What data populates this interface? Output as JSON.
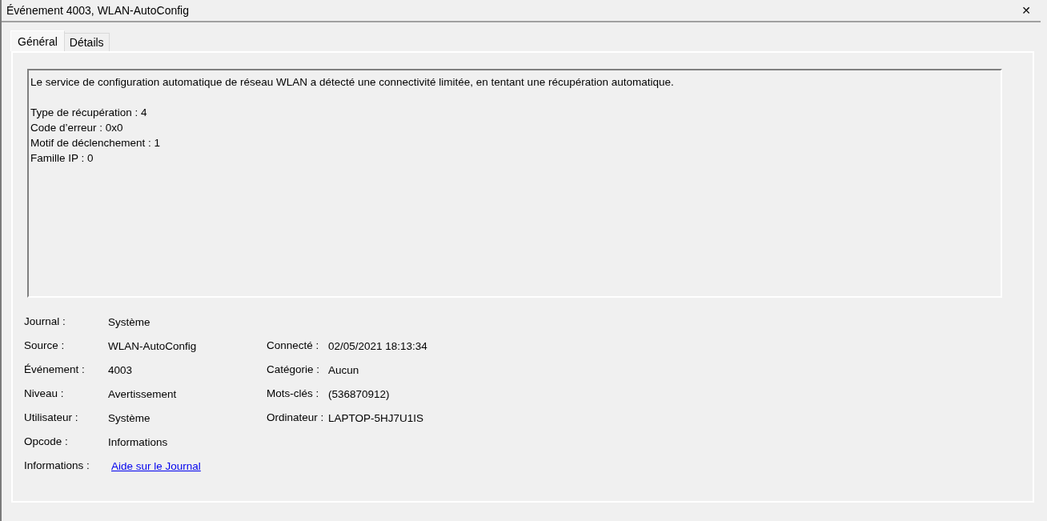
{
  "window": {
    "title": "Événement 4003, WLAN-AutoConfig",
    "close": "✕"
  },
  "tabs": [
    {
      "label": "Général",
      "selected": true
    },
    {
      "label": "Détails",
      "selected": false
    }
  ],
  "message": {
    "summary": "Le service de configuration automatique de réseau WLAN a détecté une connectivité limitée, en tentant une récupération automatique.",
    "lines": [
      "Type de récupération : 4",
      "Code d’erreur : 0x0",
      "Motif de déclenchement : 1",
      "Famille IP : 0"
    ]
  },
  "fields_left": [
    {
      "label": "Journal :",
      "value": "Système",
      "kind": "text"
    },
    {
      "label": "Source :",
      "value": "WLAN-AutoConfig",
      "kind": "text"
    },
    {
      "label": "Événement :",
      "value": "4003",
      "kind": "text"
    },
    {
      "label": "Niveau :",
      "value": "Avertissement",
      "kind": "text"
    },
    {
      "label": "Utilisateur :",
      "value": "Système",
      "kind": "text"
    },
    {
      "label": "Opcode :",
      "value": "Informations",
      "kind": "text"
    },
    {
      "label": "Informations :",
      "value": "Aide sur le Journal",
      "kind": "link"
    }
  ],
  "fields_right": [
    {
      "label": "Connecté :",
      "value": "02/05/2021 18:13:34"
    },
    {
      "label": "Catégorie :",
      "value": "Aucun"
    },
    {
      "label": "Mots-clés :",
      "value": "(536870912)"
    },
    {
      "label": "Ordinateur :",
      "value": "LAPTOP-5HJ7U1IS"
    }
  ]
}
